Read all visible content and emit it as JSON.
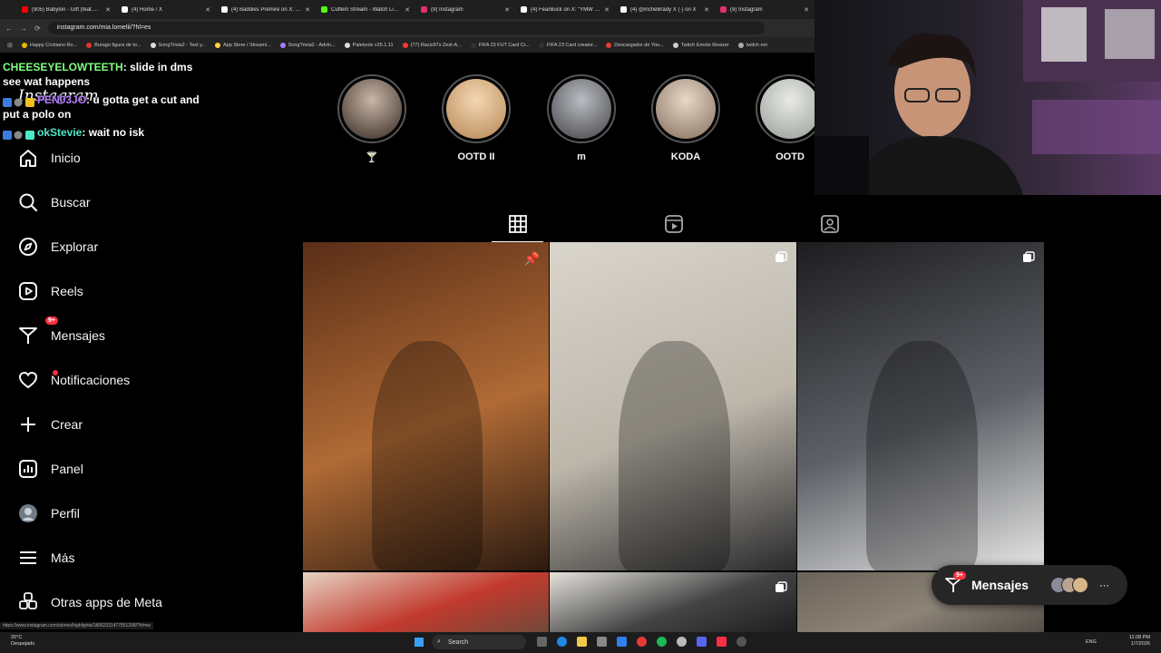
{
  "browser": {
    "tabs": [
      {
        "title": "(905) Babylon - Gift (feat.Don",
        "color": "#ff0000"
      },
      {
        "title": "(4) Home / X",
        "color": "#ffffff"
      },
      {
        "title": "(4) Baddies Premire on X: \"Ep",
        "color": "#ffffff"
      },
      {
        "title": "Cuffem Stream - Watch Live o",
        "color": "#53fc18"
      },
      {
        "title": "(9) Instagram",
        "color": "#e1306c"
      },
      {
        "title": "(4) FearBuck on X: \"YMW Mr",
        "color": "#ffffff"
      },
      {
        "title": "(4) @incheBrady X (·) on X",
        "color": "#ffffff"
      },
      {
        "title": "(9) Instagram",
        "color": "#e1306c"
      }
    ],
    "url": "instagram.com/mia.lomelii/?hl=es",
    "bookmarks": [
      {
        "label": "Happy Cristiano Ro...",
        "color": "#e6b800"
      },
      {
        "label": "Burago figura de to...",
        "color": "#d33"
      },
      {
        "label": "SongTrivia2 - Test y...",
        "color": "#ddd"
      },
      {
        "label": "App Store / Streami...",
        "color": "#ffd23f"
      },
      {
        "label": "SongTrivia2 - Advin...",
        "color": "#a77bff"
      },
      {
        "label": "Paletools v25.1.11",
        "color": "#ddd"
      },
      {
        "label": "(77) Razzi97s Zest-A...",
        "color": "#f33"
      },
      {
        "label": "FIFA 23 FUT Card Cr...",
        "color": "#333"
      },
      {
        "label": "FIFA 23 Card creator...",
        "color": "#333"
      },
      {
        "label": "Descargador de You...",
        "color": "#e53935"
      },
      {
        "label": "Twitch Emote Resizer",
        "color": "#ccc"
      },
      {
        "label": "twitch em",
        "color": "#aaa"
      }
    ]
  },
  "sidebar": {
    "logo": "Instagram",
    "messages_badge": "9+",
    "items": [
      {
        "label": "Inicio",
        "icon": "home-icon"
      },
      {
        "label": "Buscar",
        "icon": "search-icon"
      },
      {
        "label": "Explorar",
        "icon": "compass-icon"
      },
      {
        "label": "Reels",
        "icon": "reels-icon"
      },
      {
        "label": "Mensajes",
        "icon": "messenger-icon"
      },
      {
        "label": "Notificaciones",
        "icon": "heart-icon"
      },
      {
        "label": "Crear",
        "icon": "plus-icon"
      },
      {
        "label": "Panel",
        "icon": "dashboard-icon"
      },
      {
        "label": "Perfil",
        "icon": "avatar-icon"
      },
      {
        "label": "Más",
        "icon": "menu-icon"
      },
      {
        "label": "Otras apps de Meta",
        "icon": "meta-apps-icon"
      }
    ]
  },
  "chat": [
    {
      "user": "CHEESEYELOWTEETH",
      "text": ": slide in dms see wat happens"
    },
    {
      "user": "PEN03JO",
      "text": ": u gotta get a cut and put a polo on"
    },
    {
      "user": "okStevie",
      "text": ": wait no isk"
    }
  ],
  "stories": [
    {
      "label": "🍸",
      "colors": [
        "#c9b7a8",
        "#3d3028"
      ]
    },
    {
      "label": "OOTD II",
      "colors": [
        "#f4d7b3",
        "#b88a5a"
      ]
    },
    {
      "label": "m",
      "colors": [
        "#b9bcc2",
        "#4a4a4e"
      ]
    },
    {
      "label": "KODA",
      "colors": [
        "#e7d8c8",
        "#8a7462"
      ]
    },
    {
      "label": "OOTD",
      "colors": [
        "#e9eae6",
        "#9aa29a"
      ]
    }
  ],
  "profile_tabs": [
    {
      "icon": "grid-icon",
      "active": true
    },
    {
      "icon": "reels-tab-icon",
      "active": false
    },
    {
      "icon": "tagged-icon",
      "active": false
    }
  ],
  "posts": [
    {
      "type": "pinned",
      "colors": [
        "#5a2e17",
        "#b06a35",
        "#2b1a10"
      ]
    },
    {
      "type": "carousel",
      "colors": [
        "#d9d5cc",
        "#bdb7ab",
        "#2a2a2c"
      ]
    },
    {
      "type": "carousel",
      "colors": [
        "#1d1d1f",
        "#5e6168",
        "#e6e6e4"
      ]
    },
    {
      "type": "photo",
      "colors": [
        "#e6d4c4",
        "#c23a2e",
        "#6b4a3a"
      ]
    },
    {
      "type": "carousel",
      "colors": [
        "#e5e2dc",
        "#444",
        "#1c1c1c"
      ]
    },
    {
      "type": "photo",
      "colors": [
        "#6b6359",
        "#8d8478",
        "#4f4a44"
      ]
    }
  ],
  "floating_messages": {
    "label": "Mensajes",
    "badge": "9+"
  },
  "status_url": "https://www.instagram.com/stories/highlights/18062311477551208/?hl=es",
  "taskbar": {
    "weather_temp": "20°C",
    "weather_desc": "Despejado",
    "search": "Search",
    "lang": "ENG",
    "time": "11:08 PM",
    "date": "1/7/2026"
  },
  "colors": {
    "accent": "#ff3040",
    "bg": "#000000",
    "text": "#f5f5f5"
  }
}
